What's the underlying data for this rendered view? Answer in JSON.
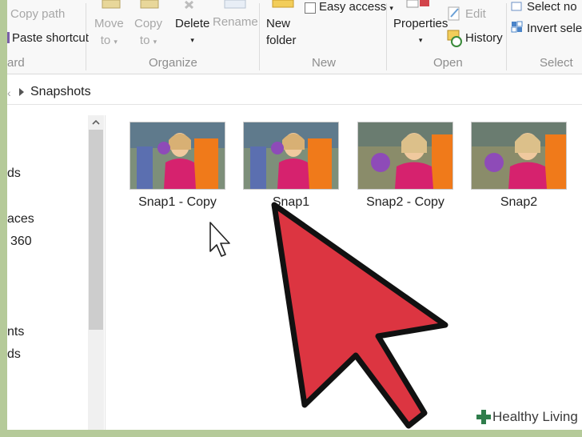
{
  "ribbon": {
    "clipboard": {
      "copy_path": "Copy path",
      "paste_shortcut": "Paste shortcut",
      "group_label": "ard"
    },
    "organize": {
      "move_to_line1": "Move",
      "move_to_line2": "to",
      "copy_to_line1": "Copy",
      "copy_to_line2": "to",
      "delete": "Delete",
      "rename": "Rename",
      "group_label": "Organize"
    },
    "new": {
      "new_folder_line1": "New",
      "new_folder_line2": "folder",
      "easy_access": "Easy access",
      "group_label": "New"
    },
    "open": {
      "properties": "Properties",
      "edit": "Edit",
      "history": "History",
      "group_label": "Open"
    },
    "select": {
      "select_none": "Select no",
      "invert_selection": "Invert sele",
      "group_label": "Select"
    }
  },
  "address": {
    "current_folder": "Snapshots"
  },
  "nav": {
    "items": [
      "ds",
      "aces",
      "360",
      "nts",
      "ds"
    ]
  },
  "files": [
    {
      "name": "Snap1 - Copy"
    },
    {
      "name": "Snap1"
    },
    {
      "name": "Snap2 - Copy"
    },
    {
      "name": "Snap2"
    }
  ],
  "watermark": {
    "text": "Healthy Living"
  },
  "colors": {
    "frame": "#b5ca99",
    "arrow_fill": "#dc3541",
    "arrow_stroke": "#111111",
    "thumb_shirt": "#d6226e",
    "thumb_slide": "#f07a1a",
    "thumb_bg": "#7d8f7a",
    "watermark_cross": "#2f7d4b"
  },
  "icons": [
    "copy-path-icon",
    "paste-shortcut-icon",
    "move-to-icon",
    "copy-to-icon",
    "delete-icon",
    "rename-icon",
    "new-folder-icon",
    "easy-access-icon",
    "properties-icon",
    "edit-icon",
    "history-icon",
    "select-none-icon",
    "invert-selection-icon",
    "red-arrow-icon",
    "mouse-pointer-icon",
    "cross-logo-icon"
  ]
}
